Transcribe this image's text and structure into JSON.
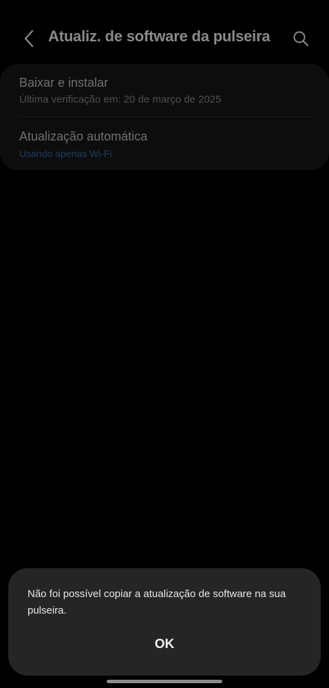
{
  "header": {
    "title": "Atualiz. de software da pulseira",
    "back_icon": "chevron-left-icon",
    "search_icon": "search-icon"
  },
  "settings": {
    "download": {
      "title": "Baixar e instalar",
      "subtitle": "Última verificação em: 20 de março de 2025"
    },
    "auto_update": {
      "title": "Atualização automática",
      "subtitle": "Usando apenas Wi-Fi"
    }
  },
  "dialog": {
    "message": "Não foi possível copiar a atualização de software na sua pulseira.",
    "ok_label": "OK"
  },
  "colors": {
    "background": "#000000",
    "dialog_bg": "#252525",
    "accent": "#1c3e63"
  }
}
